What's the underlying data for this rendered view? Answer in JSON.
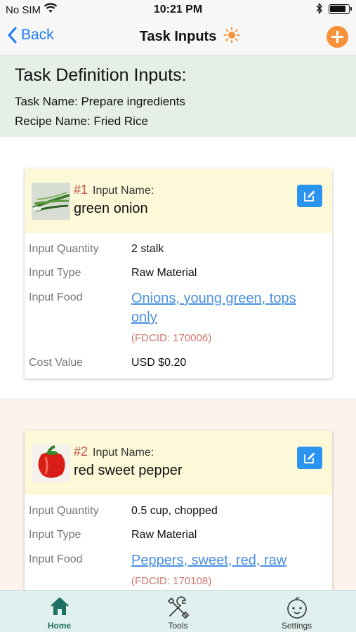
{
  "status_bar": {
    "carrier": "No SIM",
    "time": "10:21 PM"
  },
  "nav": {
    "back_label": "Back",
    "title": "Task Inputs",
    "accent_color": "#f7923a",
    "link_color": "#1a7cf4"
  },
  "header": {
    "title": "Task Definition Inputs:",
    "task_line": "Task Name: Prepare ingredients",
    "recipe_line": "Recipe Name: Fried Rice"
  },
  "inputs": [
    {
      "number": "#1",
      "label": "Input Name:",
      "name": "green onion",
      "image": "green-onion-thumbnail",
      "rows": {
        "quantity_label": "Input Quantity",
        "quantity": "2 stalk",
        "type_label": "Input Type",
        "type": "Raw Material",
        "food_label": "Input Food",
        "food": "Onions, young green, tops only",
        "fdcid": "(FDCID: 170006)",
        "cost_label": "Cost Value",
        "cost": "USD $0.20"
      }
    },
    {
      "number": "#2",
      "label": "Input Name:",
      "name": "red sweet pepper",
      "image": "red-pepper-thumbnail",
      "rows": {
        "quantity_label": "Input Quantity",
        "quantity": "0.5 cup, chopped",
        "type_label": "Input Type",
        "type": "Raw Material",
        "food_label": "Input Food",
        "food": "Peppers, sweet, red, raw",
        "fdcid": "(FDCID: 170108)"
      }
    }
  ],
  "tabs": [
    {
      "label": "Home",
      "icon": "home-icon",
      "active": true
    },
    {
      "label": "Tools",
      "icon": "tools-icon",
      "active": false
    },
    {
      "label": "Settings",
      "icon": "baby-face-icon",
      "active": false
    }
  ],
  "colors": {
    "header_bg": "#e6efe6",
    "card_head_bg": "#fdf9d8",
    "edit_button": "#2b93f0",
    "number_red": "#c0504d",
    "tab_bar_bg": "#dff0ee",
    "tab_active": "#1f6f62"
  }
}
